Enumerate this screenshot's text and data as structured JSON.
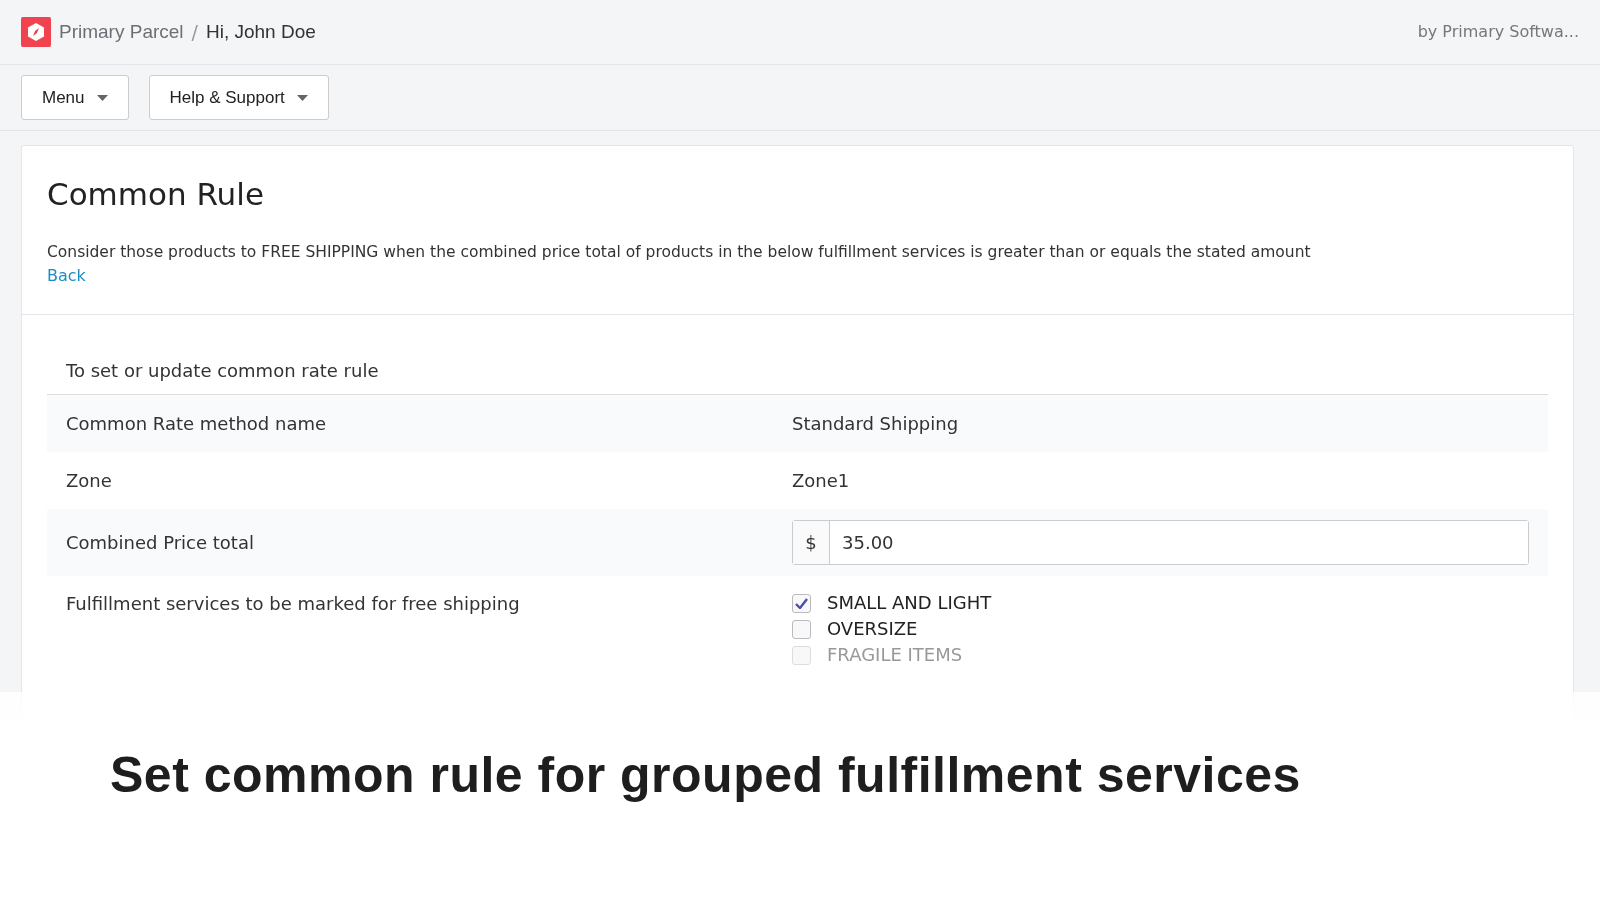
{
  "header": {
    "brand": "Primary Parcel",
    "separator": "/",
    "greeting": "Hi, John Doe",
    "vendor": "by Primary Softwa..."
  },
  "toolbar": [
    "Menu",
    "Help & Support"
  ],
  "card": {
    "title": "Common Rule",
    "description": "Consider those products to FREE SHIPPING when the combined price total of products in the below fulfillment services is greater than or equals the stated amount",
    "back_link": "Back"
  },
  "form": {
    "heading": "To set or update common rate rule",
    "rows": [
      {
        "kind": "text",
        "label": "Common Rate method name",
        "value": "Standard Shipping"
      },
      {
        "kind": "text",
        "label": "Zone",
        "value": "Zone1"
      },
      {
        "kind": "money",
        "label": "Combined Price total",
        "prefix": "$",
        "value": "35.00"
      },
      {
        "kind": "checks",
        "label": "Fulfillment services to be marked for free shipping",
        "options": [
          {
            "label": "SMALL AND LIGHT",
            "checked": true,
            "disabled": false
          },
          {
            "label": "OVERSIZE",
            "checked": false,
            "disabled": false
          },
          {
            "label": "FRAGILE ITEMS",
            "checked": false,
            "disabled": true
          }
        ]
      }
    ]
  },
  "caption": "Set common rule for grouped fulfillment services"
}
